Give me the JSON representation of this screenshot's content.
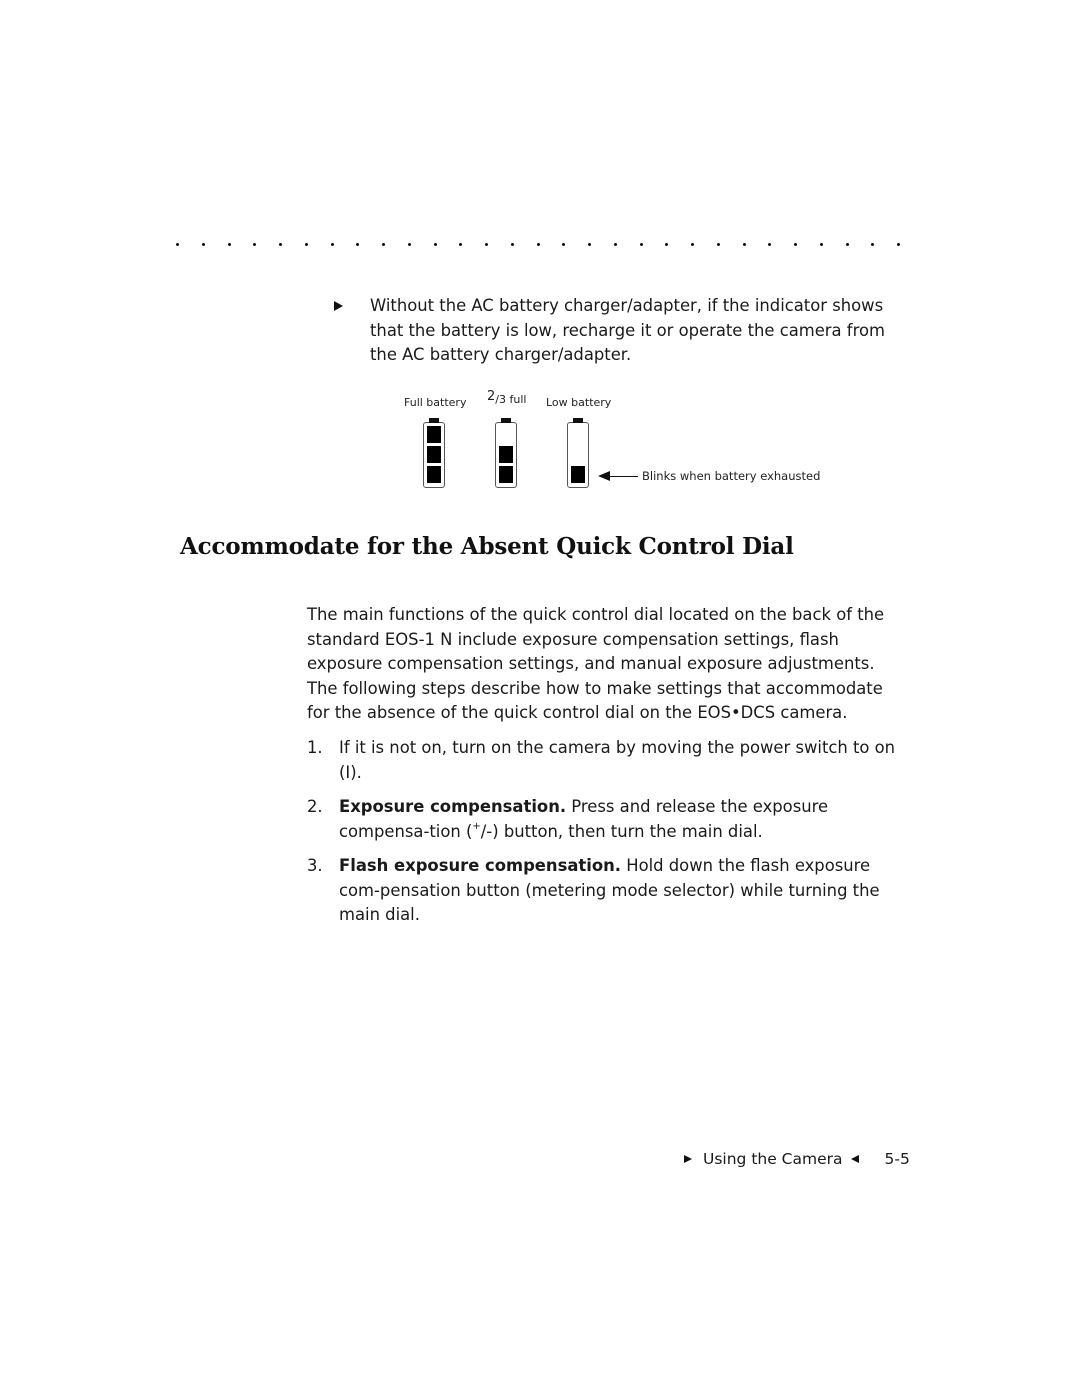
{
  "separator": {
    "dot_count": 29
  },
  "bullet_note": {
    "icon": "right-triangle-bullet-icon",
    "text": "Without the AC battery charger/adapter, if the indicator shows that the battery is low, recharge it or operate the camera from the AC battery charger/adapter."
  },
  "battery_figure": {
    "indicators": [
      {
        "label": "Full battery",
        "filled_segments": 3,
        "total_segments": 3
      },
      {
        "label_sup": "2",
        "label_rest": "/3 full",
        "filled_segments": 2,
        "total_segments": 3
      },
      {
        "label": "Low battery",
        "filled_segments": 1,
        "total_segments": 3
      }
    ],
    "callout": "Blinks when battery exhausted",
    "callout_icon": "left-arrow-icon"
  },
  "section": {
    "title": "Accommodate for the Absent Quick Control Dial",
    "intro": "The main functions of the quick control dial located on the back of the standard EOS-1 N include exposure compensation settings, flash exposure compensation settings, and manual exposure adjustments. The following steps describe how to make settings that accommodate for the absence of the quick control dial on the EOS•DCS camera.",
    "steps": [
      {
        "number": "1.",
        "bold": "",
        "text": "If it is not on, turn on the camera by moving the power switch to on (I)."
      },
      {
        "number": "2.",
        "bold": "Exposure compensation.",
        "text_before_sup": " Press and release the exposure compensa-tion (",
        "sup": "+",
        "text_after_sup": "/-) button, then turn the main dial."
      },
      {
        "number": "3.",
        "bold": "Flash exposure compensation.",
        "text": " Hold down the flash exposure com-pensation button (metering mode selector) while turning the main dial."
      }
    ]
  },
  "footer": {
    "section_name": "Using the Camera",
    "page_number": "5-5",
    "left_icon": "right-triangle-icon",
    "right_icon": "left-triangle-icon"
  }
}
